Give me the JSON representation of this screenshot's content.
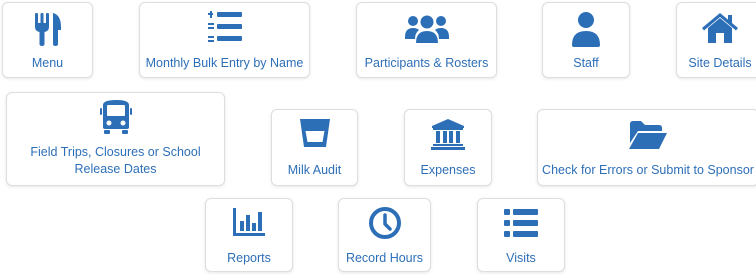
{
  "accent_color": "#2d6fb7",
  "tiles": {
    "menu": {
      "label": "Menu",
      "icon": "utensils-icon"
    },
    "bulk_entry": {
      "label": "Monthly Bulk Entry by Name",
      "icon": "numbered-list-icon"
    },
    "participants": {
      "label": "Participants & Rosters",
      "icon": "users-icon"
    },
    "staff": {
      "label": "Staff",
      "icon": "user-icon"
    },
    "site_details": {
      "label": "Site Details",
      "icon": "home-icon"
    },
    "field_trips": {
      "label": "Field Trips, Closures or School Release Dates",
      "icon": "bus-icon"
    },
    "milk_audit": {
      "label": "Milk Audit",
      "icon": "glass-icon"
    },
    "expenses": {
      "label": "Expenses",
      "icon": "bank-icon"
    },
    "check_errors": {
      "label": "Check for Errors or Submit to Sponsor",
      "icon": "folder-open-icon"
    },
    "reports": {
      "label": "Reports",
      "icon": "bar-chart-icon"
    },
    "record_hours": {
      "label": "Record Hours",
      "icon": "clock-icon"
    },
    "visits": {
      "label": "Visits",
      "icon": "list-icon"
    }
  }
}
